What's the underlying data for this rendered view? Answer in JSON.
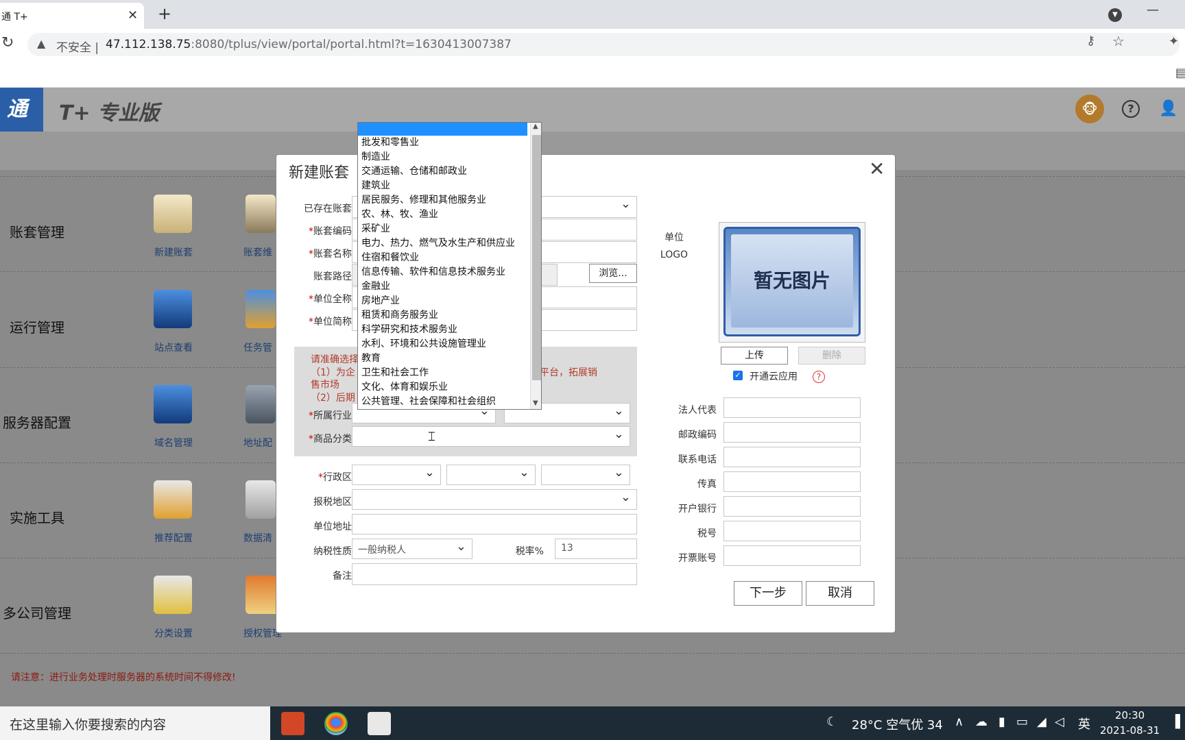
{
  "browser": {
    "tab_title": "通 T+",
    "tab_close": "✕",
    "new_tab": "+",
    "security": "不安全",
    "url_host": "47.112.138.75",
    "url_rest": ":8080/tplus/view/portal/portal.html?t=1630413007387"
  },
  "app": {
    "brand_short": "通",
    "product_name": "T+ 专业版",
    "categories": [
      "账套管理",
      "运行管理",
      "服务器配置",
      "实施工具",
      "多公司管理"
    ],
    "icons": [
      [
        "新建账套",
        "账套维"
      ],
      [
        "站点查看",
        "任务管"
      ],
      [
        "域名管理",
        "地址配"
      ],
      [
        "推荐配置",
        "数据清"
      ],
      [
        "分类设置",
        "授权管理"
      ]
    ],
    "notice": "请注意：进行业务处理时服务器的系统时间不得修改!"
  },
  "dialog": {
    "title": "新建账套",
    "close": "✕",
    "labels": {
      "existing": "已存在账套",
      "code": "账套编码",
      "name": "账套名称",
      "path": "账套路径",
      "full_name": "单位全称",
      "short_name": "单位简称",
      "industry": "所属行业",
      "goods": "商品分类",
      "region": "行政区",
      "tax_region": "报税地区",
      "address": "单位地址",
      "tax_type": "纳税性质",
      "tax_rate": "税率%",
      "remark": "备注",
      "logo1": "单位",
      "logo2": "LOGO",
      "legal": "法人代表",
      "postcode": "邮政编码",
      "phone": "联系电话",
      "fax": "传真",
      "bank": "开户银行",
      "tax_no": "税号",
      "invoice": "开票账号"
    },
    "browse": "浏览...",
    "notice_lines": [
      "请准确选择",
      "（1）为企",
      "网上平台，拓展销",
      "售市场",
      "（2）后期"
    ],
    "tax_type_value": "一般纳税人",
    "tax_rate_value": "13",
    "logo_placeholder": "暂无图片",
    "upload": "上传",
    "delete": "删除",
    "cloud_app": "开通云应用",
    "next": "下一步",
    "cancel": "取消"
  },
  "dropdown": {
    "items": [
      "批发和零售业",
      "制造业",
      "交通运输、仓储和邮政业",
      "建筑业",
      "居民服务、修理和其他服务业",
      "农、林、牧、渔业",
      "采矿业",
      "电力、热力、燃气及水生产和供应业",
      "住宿和餐饮业",
      "信息传输、软件和信息技术服务业",
      "金融业",
      "房地产业",
      "租赁和商务服务业",
      "科学研究和技术服务业",
      "水利、环境和公共设施管理业",
      "教育",
      "卫生和社会工作",
      "文化、体育和娱乐业",
      "公共管理、社会保障和社会组织"
    ]
  },
  "taskbar": {
    "search": "在这里输入你要搜索的内容",
    "weather": "28°C 空气优 34",
    "ime": "英",
    "time": "20:30",
    "date": "2021-08-31"
  }
}
